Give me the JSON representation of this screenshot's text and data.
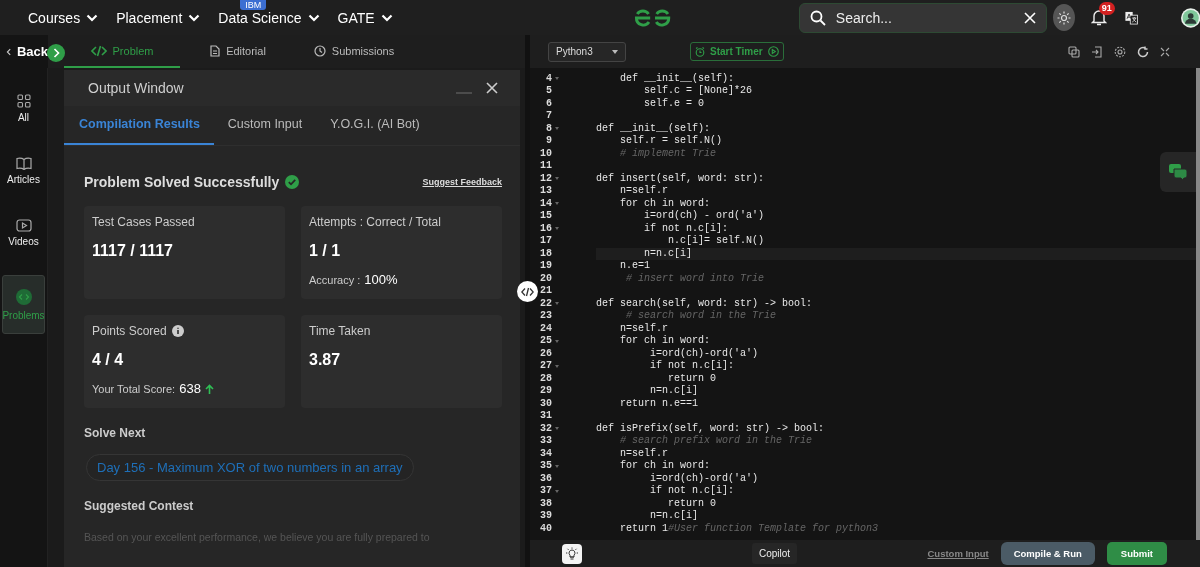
{
  "top_nav": {
    "menus": [
      {
        "label": "Courses"
      },
      {
        "label": "Placement"
      },
      {
        "label": "Data Science",
        "badge": "IBM"
      },
      {
        "label": "GATE"
      }
    ],
    "search": {
      "placeholder": "Search..."
    },
    "notifications": "91"
  },
  "problem_bar": {
    "back": "Back",
    "tabs": [
      {
        "label": "Problem",
        "selected": true
      },
      {
        "label": "Editorial",
        "selected": false
      },
      {
        "label": "Submissions",
        "selected": false
      }
    ]
  },
  "sidebar": {
    "items": [
      {
        "label": "All",
        "selected": false
      },
      {
        "label": "Articles",
        "selected": false
      },
      {
        "label": "Videos",
        "selected": false
      },
      {
        "label": "Problems",
        "selected": true
      }
    ]
  },
  "output_window": {
    "title": "Output Window",
    "tabs": [
      {
        "label": "Compilation Results",
        "selected": true
      },
      {
        "label": "Custom Input",
        "selected": false
      },
      {
        "label": "Y.O.G.I. (AI Bot)",
        "selected": false
      }
    ],
    "status": "Problem Solved Successfully",
    "feedback_link": "Suggest Feedback",
    "stats": [
      {
        "label": "Test Cases Passed",
        "value": "1117 / 1117"
      },
      {
        "label": "Attempts : Correct / Total",
        "value": "1 / 1",
        "detail_label": "Accuracy :",
        "detail_value": "100%"
      },
      {
        "label": "Points Scored",
        "info": true,
        "value": "4 / 4",
        "detail_label": "Your Total Score:",
        "detail_value": "638",
        "rising": true
      },
      {
        "label": "Time Taken",
        "value": "3.87"
      }
    ],
    "solve_next_heading": "Solve Next",
    "next_problem": "Day 156 - Maximum XOR of two numbers in an array",
    "contest_heading": "Suggested Contest",
    "contest_text": "Based on your excellent performance, we believe you are fully prepared to"
  },
  "editor": {
    "language": "Python3",
    "timer": "Start Timer",
    "lines": [
      {
        "number": "4",
        "code": "    def __init__(self):",
        "fold": true
      },
      {
        "number": "5",
        "code": "        self.c = [None]*26"
      },
      {
        "number": "6",
        "code": "        self.e = 0"
      },
      {
        "number": "7"
      },
      {
        "number": "8",
        "code": "def __init__(self):",
        "fold": true
      },
      {
        "number": "9",
        "code": "    self.r = self.N()"
      },
      {
        "number": "10",
        "comment": "    # implement Trie"
      },
      {
        "number": "11"
      },
      {
        "number": "12",
        "code": "def insert(self, word: str):",
        "fold": true
      },
      {
        "number": "13",
        "code": "    n=self.r"
      },
      {
        "number": "14",
        "code": "    for ch in word:",
        "fold": true
      },
      {
        "number": "15",
        "code": "        i=ord(ch) - ord('a')"
      },
      {
        "number": "16",
        "code": "        if not n.c[i]:",
        "fold": true
      },
      {
        "number": "17",
        "code": "            n.c[i]= self.N()"
      },
      {
        "number": "18",
        "code": "        n=n.c[i]",
        "current": true
      },
      {
        "number": "19",
        "code": "    n.e=1"
      },
      {
        "number": "20",
        "comment": "     # insert word into Trie"
      },
      {
        "number": "21"
      },
      {
        "number": "22",
        "code": "def search(self, word: str) -> bool:",
        "fold": true
      },
      {
        "number": "23",
        "comment": "     # search word in the Trie"
      },
      {
        "number": "24",
        "code": "    n=self.r"
      },
      {
        "number": "25",
        "code": "    for ch in word:",
        "fold": true
      },
      {
        "number": "26",
        "code": "         i=ord(ch)-ord('a')"
      },
      {
        "number": "27",
        "code": "         if not n.c[i]:",
        "fold": true
      },
      {
        "number": "28",
        "code": "            return 0"
      },
      {
        "number": "29",
        "code": "         n=n.c[i]"
      },
      {
        "number": "30",
        "code": "    return n.e==1"
      },
      {
        "number": "31"
      },
      {
        "number": "32",
        "code": "def isPrefix(self, word: str) -> bool:",
        "fold": true
      },
      {
        "number": "33",
        "comment": "    # search prefix word in the Trie"
      },
      {
        "number": "34",
        "code": "    n=self.r"
      },
      {
        "number": "35",
        "code": "    for ch in word:",
        "fold": true
      },
      {
        "number": "36",
        "code": "         i=ord(ch)-ord('a')"
      },
      {
        "number": "37",
        "code": "         if not n.c[i]:",
        "fold": true
      },
      {
        "number": "38",
        "code": "            return 0"
      },
      {
        "number": "39",
        "code": "         n=n.c[i]"
      },
      {
        "number": "40",
        "code": "    return 1",
        "comment": "#User function Template for python3"
      }
    ]
  },
  "bottom_bar": {
    "copilot": "Copilot",
    "custom_input": "Custom Input",
    "compile": "Compile & Run",
    "submit": "Submit"
  }
}
